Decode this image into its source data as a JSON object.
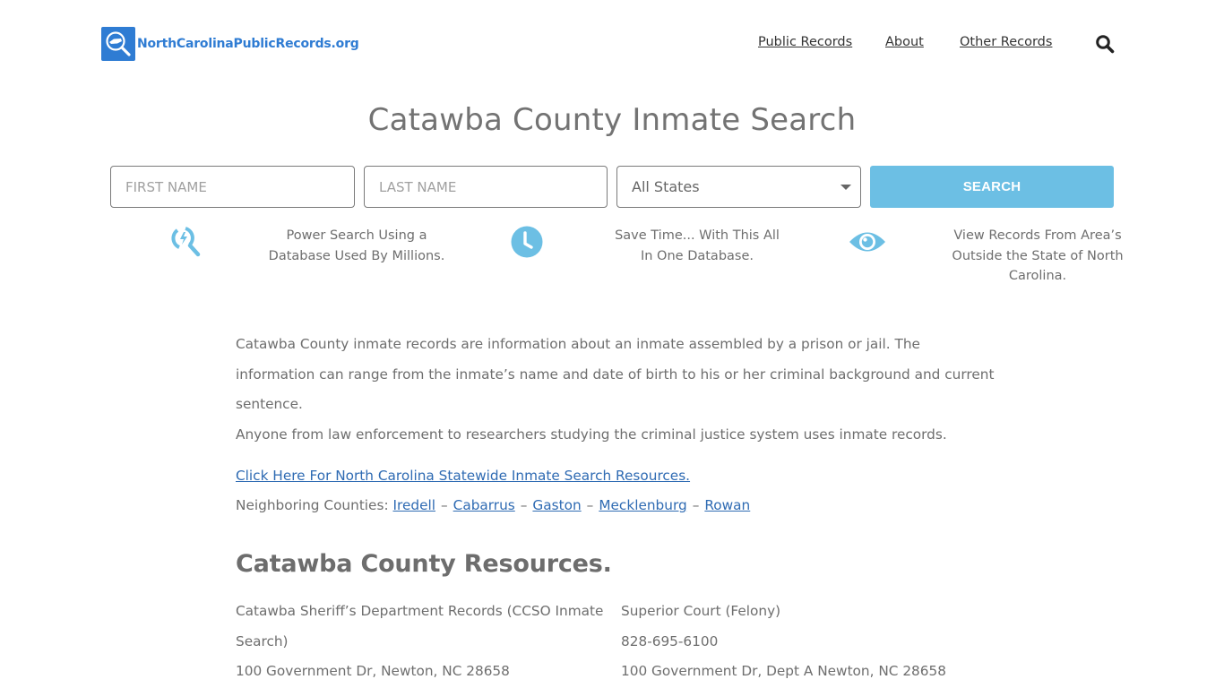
{
  "header": {
    "logo_text": "NorthCarolinaPublicRecords.org",
    "logo_icon": "magnifier-nc-map-icon",
    "brand_color": "#2f7cd3",
    "nav": [
      {
        "label": "Public Records"
      },
      {
        "label": "About"
      },
      {
        "label": "Other Records"
      }
    ],
    "search_icon": "search-icon"
  },
  "page": {
    "title": "Catawba County Inmate Search"
  },
  "search_form": {
    "first_name_placeholder": "FIRST NAME",
    "first_name_value": "",
    "last_name_placeholder": "LAST NAME",
    "last_name_value": "",
    "state_selected": "All States",
    "submit_label": "SEARCH",
    "accent_color": "#6cbfe4"
  },
  "features": [
    {
      "icon": "power-search-icon",
      "text": "Power Search Using a Database Used By Millions."
    },
    {
      "icon": "clock-icon",
      "text": "Save Time... With This All In One Database."
    },
    {
      "icon": "eye-icon",
      "text": "View Records From Area’s Outside the State of North Carolina."
    }
  ],
  "content": {
    "paragraph_1": "Catawba County inmate records are information about an inmate assembled by a prison or jail. The information can range from the inmate’s name and date of birth to his or her criminal background and current sentence.",
    "paragraph_2": "Anyone from law enforcement to researchers studying the criminal justice system uses inmate records.",
    "statewide_link": "Click Here For North Carolina Statewide Inmate Search Resources.",
    "neighbors_label": "Neighboring Counties:",
    "neighbors_separator": "–",
    "neighbors": [
      "Iredell",
      "Cabarrus",
      "Gaston",
      "Mecklenburg",
      "Rowan"
    ]
  },
  "resources": {
    "title": "Catawba County Resources.",
    "items": [
      {
        "name": "Catawba Sheriff’s Department Records (CCSO Inmate Search)",
        "address": "100 Government Dr, Newton, NC 28658"
      },
      {
        "name": "Superior Court (Felony)",
        "phone": "828-695-6100",
        "address": "100 Government Dr, Dept A Newton, NC 28658"
      }
    ]
  }
}
